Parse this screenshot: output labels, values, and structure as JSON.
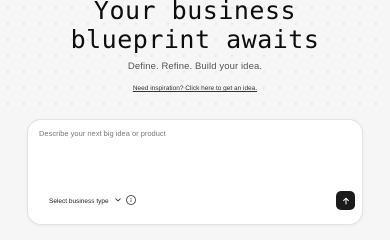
{
  "hero": {
    "title_line1": "Your business",
    "title_line2": "blueprint awaits",
    "subtitle": "Define. Refine. Build your idea.",
    "inspiration_link": "Need inspiration? Click here to get an idea."
  },
  "composer": {
    "placeholder": "Describe your next big idea or product",
    "value": "",
    "business_type_label": "Select business type",
    "info_icon": "info-icon",
    "submit_icon": "arrow-up-icon"
  },
  "colors": {
    "background": "#f6f6f6",
    "card": "#ffffff",
    "submit_button": "#1b1b1b"
  }
}
